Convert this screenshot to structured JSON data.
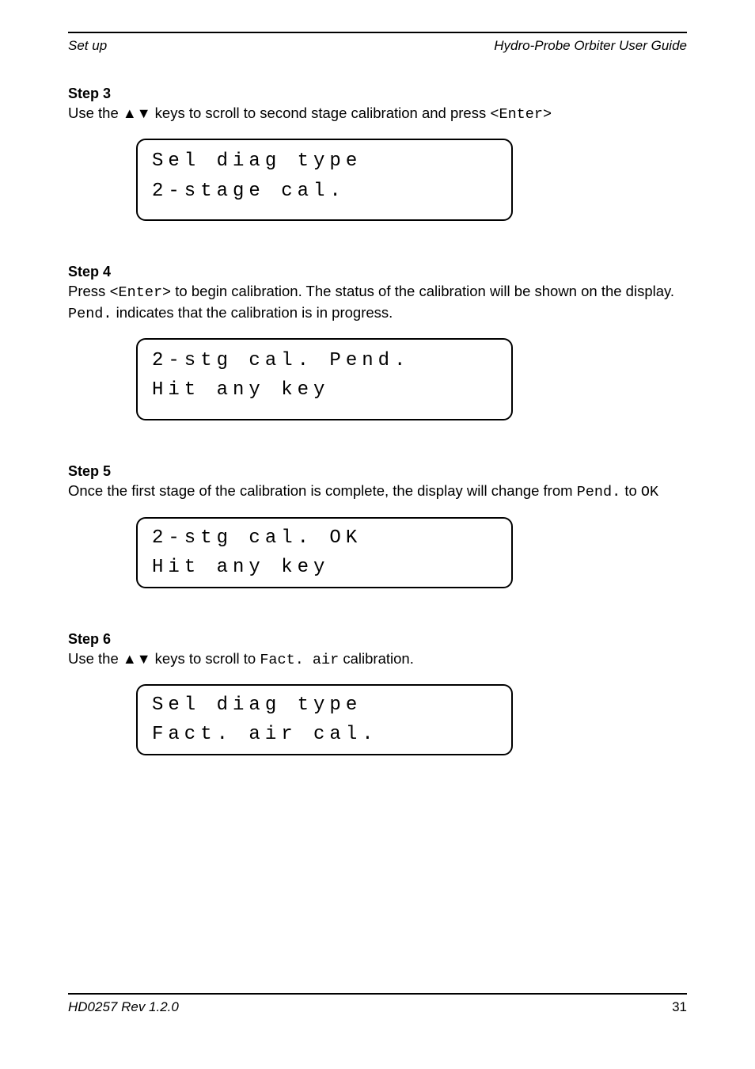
{
  "header": {
    "left": "Set up",
    "right": "Hydro-Probe Orbiter User Guide",
    "page_title": "HD0257 Rev 1.2.0",
    "page_num": "31"
  },
  "arrows": "▲▼",
  "steps": [
    {
      "head": "Step 3",
      "body_prefix": "Use the ",
      "body_mid": " keys to scroll to second stage calibration and press ",
      "enter": "<Enter>",
      "display_line1": "Sel diag type",
      "display_line2": "2-stage cal."
    },
    {
      "head": "Step 4",
      "body_part1": "Press ",
      "body_part2": " to begin calibration. The status of the calibration will be shown on the display. ",
      "body_part3": " indicates that the calibration is in progress.",
      "enter": "<Enter>",
      "pending": "Pend.",
      "display_line1": "2-stg cal. Pend.",
      "display_line2": "Hit any key"
    },
    {
      "head": "Step 5",
      "body_part1": "Once the first stage of the calibration is complete, the display will change from ",
      "body_part2": " to ",
      "pend": "Pend.",
      "ok": "OK",
      "display_line1": "2-stg cal. OK",
      "display_line2": "Hit any key"
    },
    {
      "head": "Step 6",
      "body_prefix": "Use the ",
      "body_mid": " keys to scroll to ",
      "body_suffix": " calibration.",
      "fact_air": "Fact. air",
      "display_line1": "Sel diag type",
      "display_line2": "Fact. air cal."
    }
  ]
}
